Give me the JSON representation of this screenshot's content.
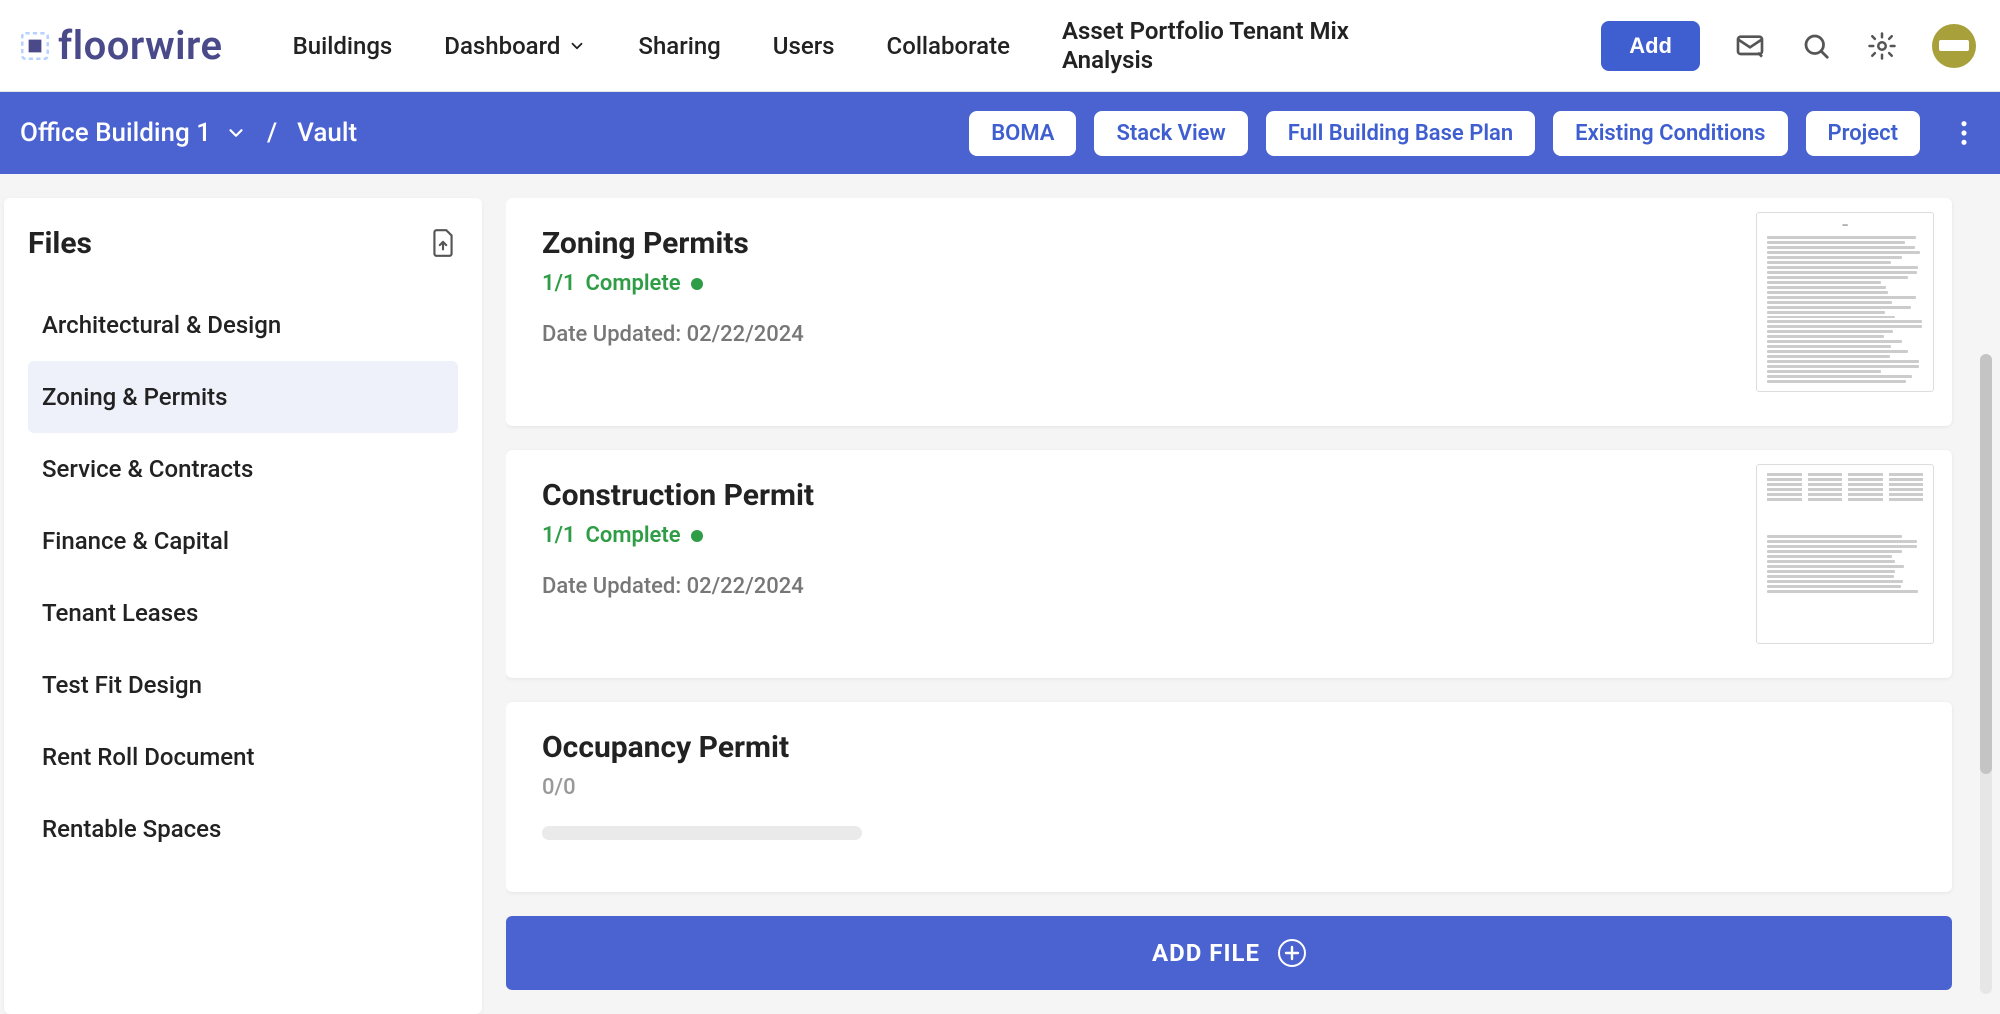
{
  "brand": {
    "name": "floorwire"
  },
  "nav": {
    "buildings": "Buildings",
    "dashboard": "Dashboard",
    "sharing": "Sharing",
    "users": "Users",
    "collaborate": "Collaborate",
    "heading": "Asset Portfolio Tenant Mix Analysis"
  },
  "actions": {
    "add": "Add"
  },
  "breadcrumb": {
    "building": "Office Building 1",
    "separator": "/",
    "section": "Vault"
  },
  "view_pills": {
    "boma": "BOMA",
    "stack": "Stack View",
    "base": "Full Building Base Plan",
    "existing": "Existing Conditions",
    "project": "Project"
  },
  "sidebar": {
    "title": "Files",
    "categories": [
      {
        "label": "Architectural & Design",
        "active": false
      },
      {
        "label": "Zoning & Permits",
        "active": true
      },
      {
        "label": "Service & Contracts",
        "active": false
      },
      {
        "label": "Finance & Capital",
        "active": false
      },
      {
        "label": "Tenant Leases",
        "active": false
      },
      {
        "label": "Test Fit Design",
        "active": false
      },
      {
        "label": "Rent Roll Document",
        "active": false
      },
      {
        "label": "Rentable Spaces",
        "active": false
      }
    ]
  },
  "cards": [
    {
      "title": "Zoning Permits",
      "count": "1/1",
      "status": "Complete",
      "updated_label": "Date Updated:",
      "updated_value": "02/22/2024",
      "has_thumb": true,
      "thumb_style": "doc"
    },
    {
      "title": "Construction Permit",
      "count": "1/1",
      "status": "Complete",
      "updated_label": "Date Updated:",
      "updated_value": "02/22/2024",
      "has_thumb": true,
      "thumb_style": "table"
    },
    {
      "title": "Occupancy Permit",
      "count": "0/0",
      "status": "",
      "updated_label": "",
      "updated_value": "",
      "has_thumb": false,
      "thumb_style": ""
    }
  ],
  "add_file": {
    "label": "ADD FILE"
  }
}
